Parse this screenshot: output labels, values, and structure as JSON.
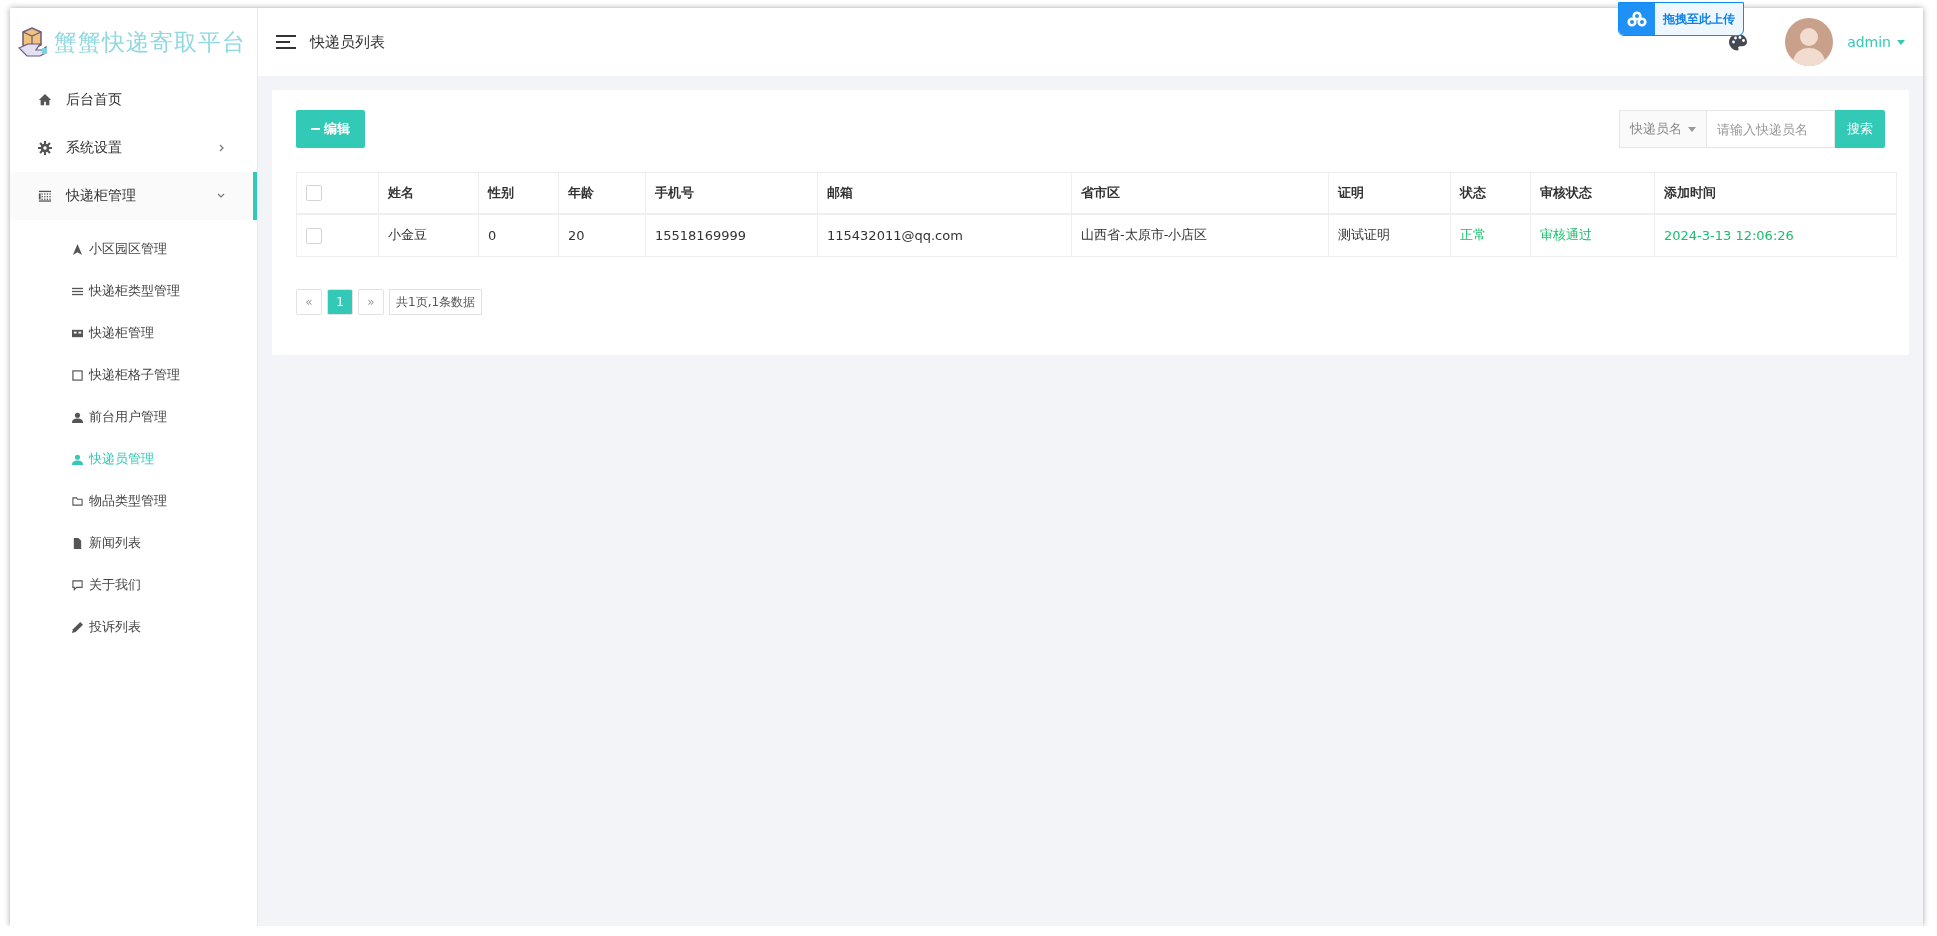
{
  "sidebar": {
    "logo": "蟹蟹快递寄取平台",
    "items": [
      {
        "kind": "home",
        "label": "后台首页",
        "expanded": false
      },
      {
        "kind": "gear",
        "label": "系统设置",
        "expanded": false
      },
      {
        "kind": "grid",
        "label": "快递柜管理",
        "expanded": true,
        "children": [
          {
            "kind": "triangle",
            "label": "小区园区管理",
            "selected": false
          },
          {
            "kind": "lines",
            "label": "快递柜类型管理",
            "selected": false
          },
          {
            "kind": "cabinet",
            "label": "快递柜管理",
            "selected": false
          },
          {
            "kind": "square",
            "label": "快递柜格子管理",
            "selected": false
          },
          {
            "kind": "user",
            "label": "前台用户管理",
            "selected": false
          },
          {
            "kind": "user",
            "label": "快递员管理",
            "selected": true
          },
          {
            "kind": "folder",
            "label": "物品类型管理",
            "selected": false
          },
          {
            "kind": "file",
            "label": "新闻列表",
            "selected": false
          },
          {
            "kind": "comment",
            "label": "关于我们",
            "selected": false
          },
          {
            "kind": "pencil",
            "label": "投诉列表",
            "selected": false
          }
        ]
      }
    ]
  },
  "header": {
    "title": "快递员列表",
    "user": "admin"
  },
  "upload_badge": {
    "text": "拖拽至此上传"
  },
  "toolbar": {
    "edit_button": "编辑",
    "search_filter": "快递员名",
    "search": {
      "placeholder": "请输入快递员名"
    },
    "search_button": "搜索"
  },
  "table": {
    "columns": [
      "姓名",
      "性别",
      "年龄",
      "手机号",
      "邮箱",
      "省市区",
      "证明",
      "状态",
      "审核状态",
      "添加时间"
    ],
    "header_checked": false,
    "rows": [
      {
        "checked": false,
        "cells": [
          {
            "text": "小金豆",
            "kind": "normal"
          },
          {
            "text": "0",
            "kind": "normal"
          },
          {
            "text": "20",
            "kind": "normal"
          },
          {
            "text": "15518169999",
            "kind": "normal"
          },
          {
            "text": "115432011@qq.com",
            "kind": "normal"
          },
          {
            "text": "山西省-太原市-小店区",
            "kind": "normal"
          },
          {
            "text": "测试证明",
            "kind": "normal"
          },
          {
            "text": "正常",
            "kind": "success"
          },
          {
            "text": "审核通过",
            "kind": "success"
          },
          {
            "text": "2024-3-13 12:06:26",
            "kind": "success"
          }
        ]
      }
    ]
  },
  "pagination": {
    "prev": "«",
    "pages": [
      {
        "label": "1",
        "selected": true
      }
    ],
    "next": "»",
    "summary": "共1页,1条数据"
  }
}
